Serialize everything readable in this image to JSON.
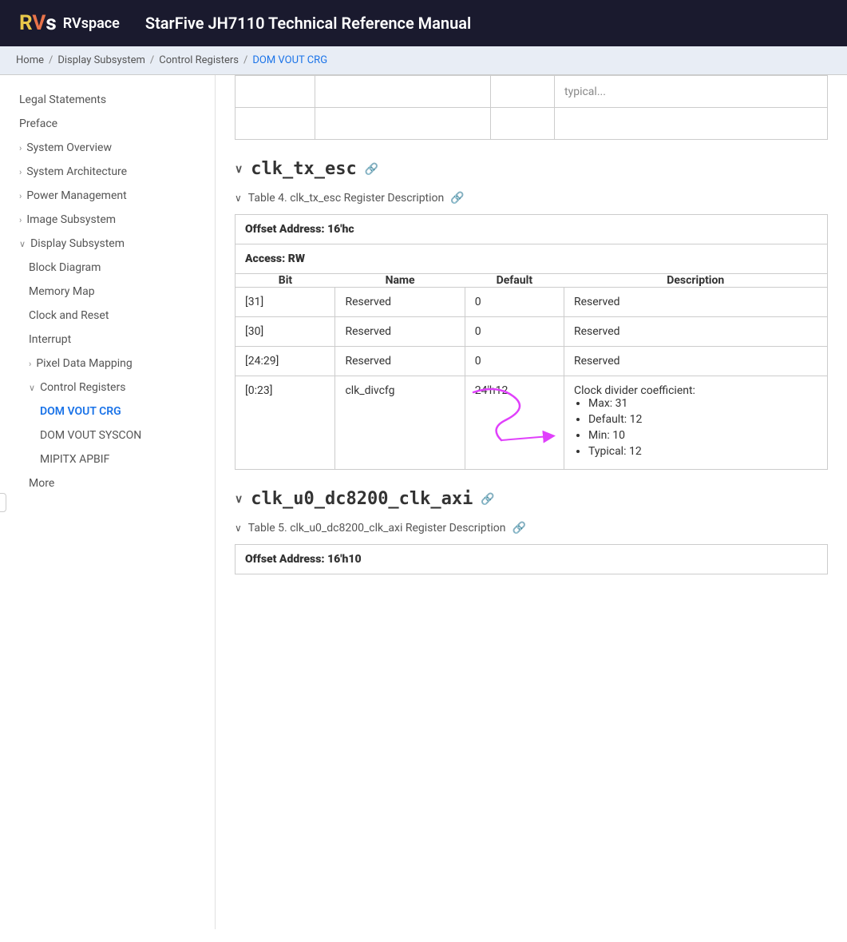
{
  "header": {
    "logo_r": "R",
    "logo_v": "V",
    "logo_s": "s",
    "brand": "RVspace",
    "title": "StarFive JH7110 Technical Reference Manual"
  },
  "breadcrumb": {
    "items": [
      "Home",
      "Display Subsystem",
      "Control Registers",
      "DOM VOUT CRG"
    ],
    "active": "DOM VOUT CRG"
  },
  "sidebar": {
    "collapse_icon": "‹",
    "items": [
      {
        "label": "Legal Statements",
        "level": 0,
        "expand": false,
        "active": false
      },
      {
        "label": "Preface",
        "level": 0,
        "expand": false,
        "active": false
      },
      {
        "label": "System Overview",
        "level": 0,
        "expand": true,
        "active": false
      },
      {
        "label": "System Architecture",
        "level": 0,
        "expand": true,
        "active": false
      },
      {
        "label": "Power Management",
        "level": 0,
        "expand": true,
        "active": false
      },
      {
        "label": "Image Subsystem",
        "level": 0,
        "expand": true,
        "active": false
      },
      {
        "label": "Display Subsystem",
        "level": 0,
        "expand": true,
        "expanded": true,
        "active": false
      },
      {
        "label": "Block Diagram",
        "level": 1,
        "expand": false,
        "active": false
      },
      {
        "label": "Memory Map",
        "level": 1,
        "expand": false,
        "active": false
      },
      {
        "label": "Clock and Reset",
        "level": 1,
        "expand": false,
        "active": false
      },
      {
        "label": "Interrupt",
        "level": 1,
        "expand": false,
        "active": false
      },
      {
        "label": "Pixel Data Mapping",
        "level": 1,
        "expand": true,
        "active": false
      },
      {
        "label": "Control Registers",
        "level": 1,
        "expand": true,
        "expanded": true,
        "active": false
      },
      {
        "label": "DOM VOUT CRG",
        "level": 2,
        "expand": false,
        "active": true
      },
      {
        "label": "DOM VOUT SYSCON",
        "level": 2,
        "expand": false,
        "active": false
      },
      {
        "label": "MIPITX APBIF",
        "level": 2,
        "expand": false,
        "active": false
      },
      {
        "label": "More",
        "level": 1,
        "expand": false,
        "active": false
      }
    ]
  },
  "main": {
    "partial_table_cells": [
      "",
      "",
      "",
      "typical..."
    ],
    "sections": [
      {
        "id": "clk_tx_esc",
        "toggle": "∨",
        "title": "clk_tx_esc",
        "link_icon": "🔗",
        "table_toggle": "∨",
        "table_title": "Table 4. clk_tx_esc Register Description",
        "table_link_icon": "🔗",
        "offset": "Offset Address: 16'hc",
        "access": "Access: RW",
        "columns": [
          "Bit",
          "Name",
          "Default",
          "Description"
        ],
        "rows": [
          {
            "bit": "[31]",
            "name": "Reserved",
            "default": "0",
            "description": "Reserved",
            "is_list": false
          },
          {
            "bit": "[30]",
            "name": "Reserved",
            "default": "0",
            "description": "Reserved",
            "is_list": false
          },
          {
            "bit": "[24:29]",
            "name": "Reserved",
            "default": "0",
            "description": "Reserved",
            "is_list": false
          },
          {
            "bit": "[0:23]",
            "name": "clk_divcfg",
            "default": "24'h12",
            "description": "Clock divider coefficient:",
            "is_list": true,
            "list_items": [
              "Max: 31",
              "Default: 12",
              "Min: 10",
              "Typical: 12"
            ]
          }
        ]
      },
      {
        "id": "clk_u0_dc8200_clk_axi",
        "toggle": "∨",
        "title": "clk_u0_dc8200_clk_axi",
        "link_icon": "🔗",
        "table_toggle": "∨",
        "table_title": "Table 5. clk_u0_dc8200_clk_axi Register Description",
        "table_link_icon": "🔗",
        "offset": "Offset Address: 16'h10",
        "access": ""
      }
    ]
  }
}
